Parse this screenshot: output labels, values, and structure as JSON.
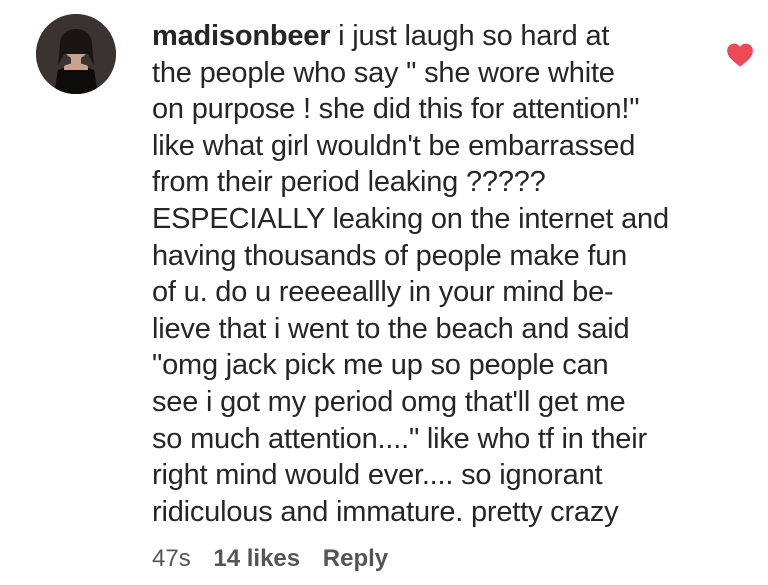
{
  "comment": {
    "username": "madisonbeer",
    "lines": [
      "i just laugh so hard at",
      "the people who say \" she wore white",
      "on purpose ! she did this for attention!\"",
      "like what girl wouldn't be embarrassed",
      "from their period leaking ?????",
      "ESPECIALLY leaking on the internet and",
      "having thousands of people make fun",
      "of u. do u reeeeallly in your mind be-",
      "lieve that i went to the beach and said",
      "\"omg jack pick me up so people can",
      "see i got my period omg that'll get me",
      "so much attention....\" like who tf in their",
      "right mind would ever.... so ignorant",
      "ridiculous and immature. pretty crazy"
    ],
    "time": "47s",
    "likes": "14 likes",
    "reply_label": "Reply",
    "liked": true,
    "heart_color": "#ed4956"
  },
  "icons": {
    "avatar": "profile-photo",
    "like": "heart-icon"
  }
}
